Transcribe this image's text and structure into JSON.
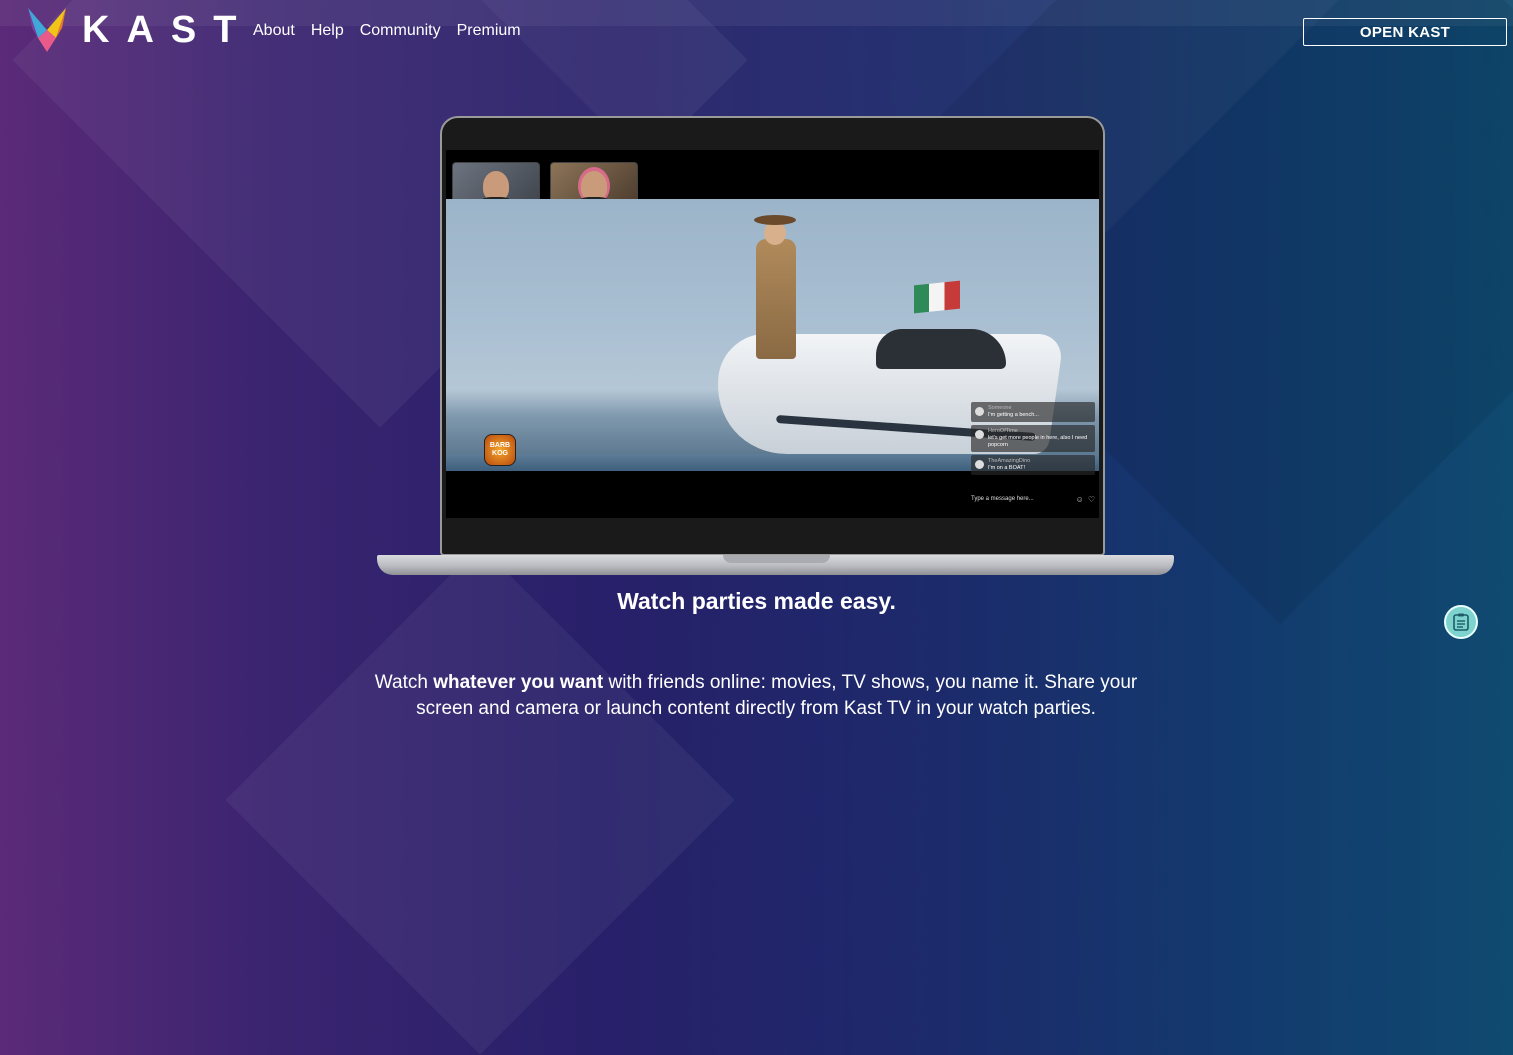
{
  "brand": {
    "name": "KAST",
    "colors": [
      "#f0c419",
      "#e85a8a",
      "#3fa8d8",
      "#7a3fa0"
    ]
  },
  "nav": {
    "items": [
      {
        "label": "About"
      },
      {
        "label": "Help"
      },
      {
        "label": "Community"
      },
      {
        "label": "Premium"
      }
    ]
  },
  "cta": {
    "open_label": "OPEN KAST"
  },
  "screen": {
    "app_badge": "BARB KOG",
    "chat": {
      "messages": [
        {
          "user": "Someone",
          "text": "I'm getting a bench..."
        },
        {
          "user": "HeroOfTime",
          "text": "let's get more people in here, also I need popcorn"
        },
        {
          "user": "TheAmazingDino",
          "text": "I'm on a BOAT!"
        }
      ],
      "input_placeholder": "Type a message here...",
      "icons": [
        "emoji-icon",
        "heart-icon"
      ]
    }
  },
  "hero": {
    "tagline": "Watch parties made easy.",
    "desc_pre": "Watch ",
    "desc_bold": "whatever you want",
    "desc_post": " with friends online: movies, TV shows, you name it. Share your screen and camera or launch content directly from Kast TV in your watch parties."
  },
  "float_icon": "notes-icon"
}
